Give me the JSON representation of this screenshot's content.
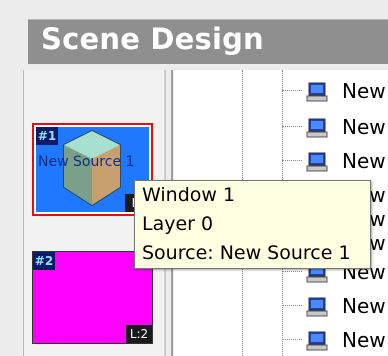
{
  "header": {
    "title": "Scene Design"
  },
  "windows": [
    {
      "number": "#1",
      "layer_label": "L:",
      "source_label": "New Source 1",
      "fill_color": "#1f78ff",
      "selected": true
    },
    {
      "number": "#2",
      "layer_label": "L:2",
      "fill_color": "#ff00ff",
      "selected": false
    }
  ],
  "tooltip": {
    "line1": "Window 1",
    "line2": "Layer 0",
    "line3": "Source: New Source 1"
  },
  "tree": {
    "items": [
      {
        "label": "New",
        "icon": "computer-icon"
      },
      {
        "label": "New",
        "icon": "computer-icon"
      },
      {
        "label": "New",
        "icon": "computer-icon"
      },
      {
        "label": "New",
        "icon": "computer-icon"
      },
      {
        "label": "New",
        "icon": "computer-icon"
      },
      {
        "label": "New",
        "icon": "computer-icon"
      },
      {
        "label": "New",
        "icon": "computer-icon"
      },
      {
        "label": "New",
        "icon": "computer-icon"
      },
      {
        "label": "New",
        "icon": "computer-icon"
      }
    ]
  },
  "colors": {
    "header_bg": "#8f8f8f",
    "selected_border": "#e01010",
    "tooltip_bg": "#ffffe1"
  }
}
